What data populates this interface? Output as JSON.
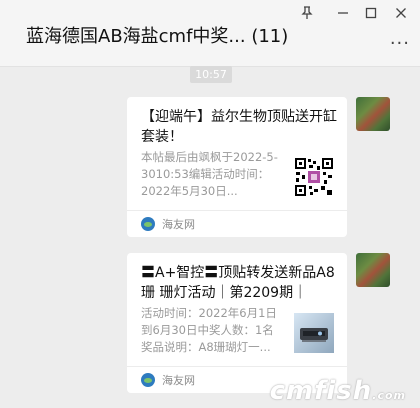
{
  "window": {
    "title": "蓝海德国AB海盐cmf中奖... (11)",
    "pin_icon": "pin-icon",
    "minimize_icon": "minimize-icon",
    "maximize_icon": "maximize-icon",
    "close_icon": "close-icon",
    "more_label": "···"
  },
  "chat": {
    "timestamp": "10:57",
    "messages": [
      {
        "title": "【迎端午】益尔生物顶贴送开缸套装！",
        "description": "本帖最后由飒枫于2022-5-3010:53编辑活动时间：2022年5月30日...",
        "thumb_icon": "qr-code-thumbnail",
        "source": "海友网"
      },
      {
        "title": "〓A+智控〓顶贴转发送新品A8珊 珊灯活动｜第2209期｜",
        "description": "活动时间：2022年6月1日到6月30日中奖人数：1名奖品说明：A8珊瑚灯一...",
        "thumb_icon": "coral-lamp-thumbnail",
        "source": "海友网"
      }
    ]
  },
  "watermark": {
    "text": "cmfish",
    "suffix": ".com"
  }
}
